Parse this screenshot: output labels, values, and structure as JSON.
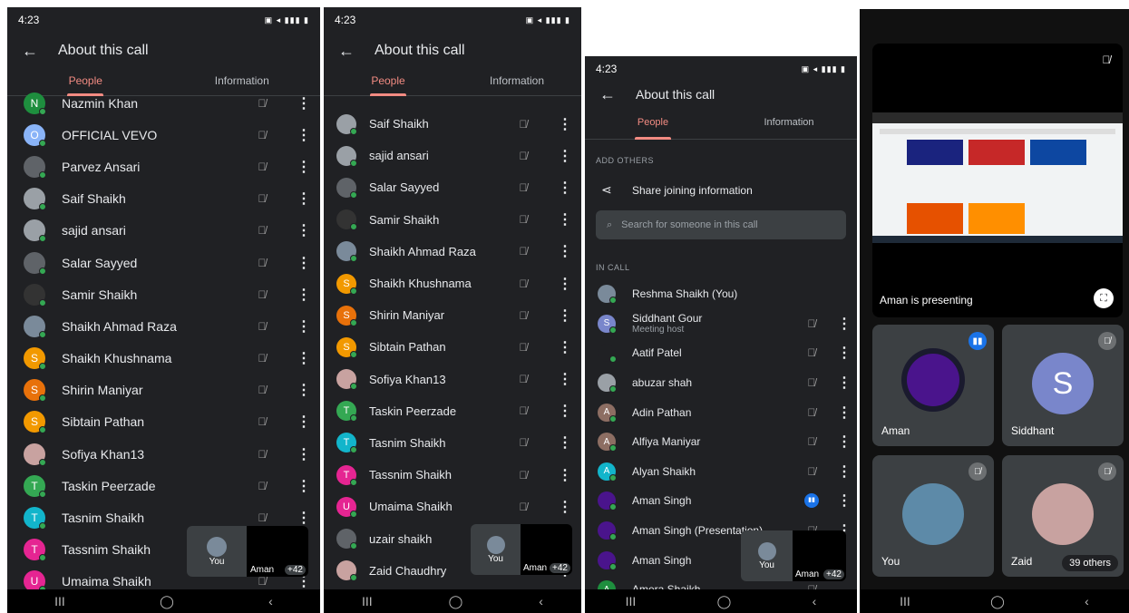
{
  "common": {
    "title": "About this call",
    "tab_people": "People",
    "tab_info": "Information",
    "back": "←",
    "nav": [
      "III",
      "◯",
      "‹"
    ],
    "you": "You",
    "aman_short": "Aman",
    "plus": "+42"
  },
  "p1": {
    "time": "4:23",
    "rows": [
      {
        "name": "Nazmin Khan",
        "c": "#1e8e3e",
        "l": "N"
      },
      {
        "name": "OFFICIAL VEVO",
        "c": "#8ab4f8",
        "l": "O"
      },
      {
        "name": "Parvez Ansari",
        "c": "#5f6368",
        "l": ""
      },
      {
        "name": "Saif Shaikh",
        "c": "#9aa0a6",
        "l": ""
      },
      {
        "name": "sajid ansari",
        "c": "#9aa0a6",
        "l": ""
      },
      {
        "name": "Salar Sayyed",
        "c": "#5f6368",
        "l": ""
      },
      {
        "name": "Samir Shaikh",
        "c": "#333",
        "l": ""
      },
      {
        "name": "Shaikh Ahmad Raza",
        "c": "#7a8a9a",
        "l": ""
      },
      {
        "name": "Shaikh Khushnama",
        "c": "#f29900",
        "l": "S"
      },
      {
        "name": "Shirin Maniyar",
        "c": "#e8710a",
        "l": "S"
      },
      {
        "name": "Sibtain Pathan",
        "c": "#f29900",
        "l": "S"
      },
      {
        "name": "Sofiya Khan13",
        "c": "#c8a2a0",
        "l": ""
      },
      {
        "name": "Taskin Peerzade",
        "c": "#34a853",
        "l": "T"
      },
      {
        "name": "Tasnim Shaikh",
        "c": "#12b5cb",
        "l": "T"
      },
      {
        "name": "Tassnim Shaikh",
        "c": "#e52592",
        "l": "T"
      },
      {
        "name": "Umaima Shaikh",
        "c": "#e52592",
        "l": "U"
      }
    ]
  },
  "p2": {
    "time": "4:23",
    "rows": [
      {
        "name": "Saif Shaikh",
        "c": "#9aa0a6",
        "l": ""
      },
      {
        "name": "sajid ansari",
        "c": "#9aa0a6",
        "l": ""
      },
      {
        "name": "Salar Sayyed",
        "c": "#5f6368",
        "l": ""
      },
      {
        "name": "Samir Shaikh",
        "c": "#333",
        "l": ""
      },
      {
        "name": "Shaikh Ahmad Raza",
        "c": "#7a8a9a",
        "l": ""
      },
      {
        "name": "Shaikh Khushnama",
        "c": "#f29900",
        "l": "S"
      },
      {
        "name": "Shirin Maniyar",
        "c": "#e8710a",
        "l": "S"
      },
      {
        "name": "Sibtain Pathan",
        "c": "#f29900",
        "l": "S"
      },
      {
        "name": "Sofiya Khan13",
        "c": "#c8a2a0",
        "l": ""
      },
      {
        "name": "Taskin Peerzade",
        "c": "#34a853",
        "l": "T"
      },
      {
        "name": "Tasnim Shaikh",
        "c": "#12b5cb",
        "l": "T"
      },
      {
        "name": "Tassnim Shaikh",
        "c": "#e52592",
        "l": "T"
      },
      {
        "name": "Umaima Shaikh",
        "c": "#e52592",
        "l": "U"
      },
      {
        "name": "uzair shaikh",
        "c": "#5f6368",
        "l": ""
      },
      {
        "name": "Zaid Chaudhry",
        "c": "#c8a2a0",
        "l": ""
      }
    ]
  },
  "p3": {
    "time": "4:23",
    "add_others": "ADD OTHERS",
    "share": "Share joining information",
    "search_placeholder": "Search for someone in this call",
    "in_call": "IN CALL",
    "host_label": "Meeting host",
    "rows": [
      {
        "name": "Reshma Shaikh (You)",
        "c": "#7a8a9a",
        "l": "",
        "mic": false,
        "more": false
      },
      {
        "name": "Siddhant Gour",
        "c": "#7986cb",
        "l": "S",
        "mic": true,
        "more": true,
        "sub": "Meeting host"
      },
      {
        "name": "Aatif Patel",
        "c": "#202124",
        "l": "",
        "mic": true,
        "more": true
      },
      {
        "name": "abuzar shah",
        "c": "#9aa0a6",
        "l": "",
        "mic": true,
        "more": true
      },
      {
        "name": "Adin Pathan",
        "c": "#8d6e63",
        "l": "A",
        "mic": true,
        "more": true
      },
      {
        "name": "Alfiya Maniyar",
        "c": "#8d6e63",
        "l": "A",
        "mic": true,
        "more": true
      },
      {
        "name": "Alyan Shaikh",
        "c": "#12b5cb",
        "l": "A",
        "mic": true,
        "more": true
      },
      {
        "name": "Aman Singh",
        "c": "#4a148c",
        "l": "",
        "mic": false,
        "speak": true,
        "more": true
      },
      {
        "name": "Aman Singh (Presentation)",
        "c": "#4a148c",
        "l": "",
        "mic": true,
        "more": true
      },
      {
        "name": "Aman Singh",
        "c": "#4a148c",
        "l": "",
        "mic": false,
        "more": false
      },
      {
        "name": "Amera Shaikh",
        "c": "#1e8e3e",
        "l": "A",
        "mic": true,
        "more": false
      }
    ]
  },
  "p4": {
    "presenting": "Aman is presenting",
    "aman": "Aman",
    "siddhant": "Siddhant",
    "s_letter": "S",
    "you": "You",
    "zaid": "Zaid",
    "others": "39 others"
  }
}
